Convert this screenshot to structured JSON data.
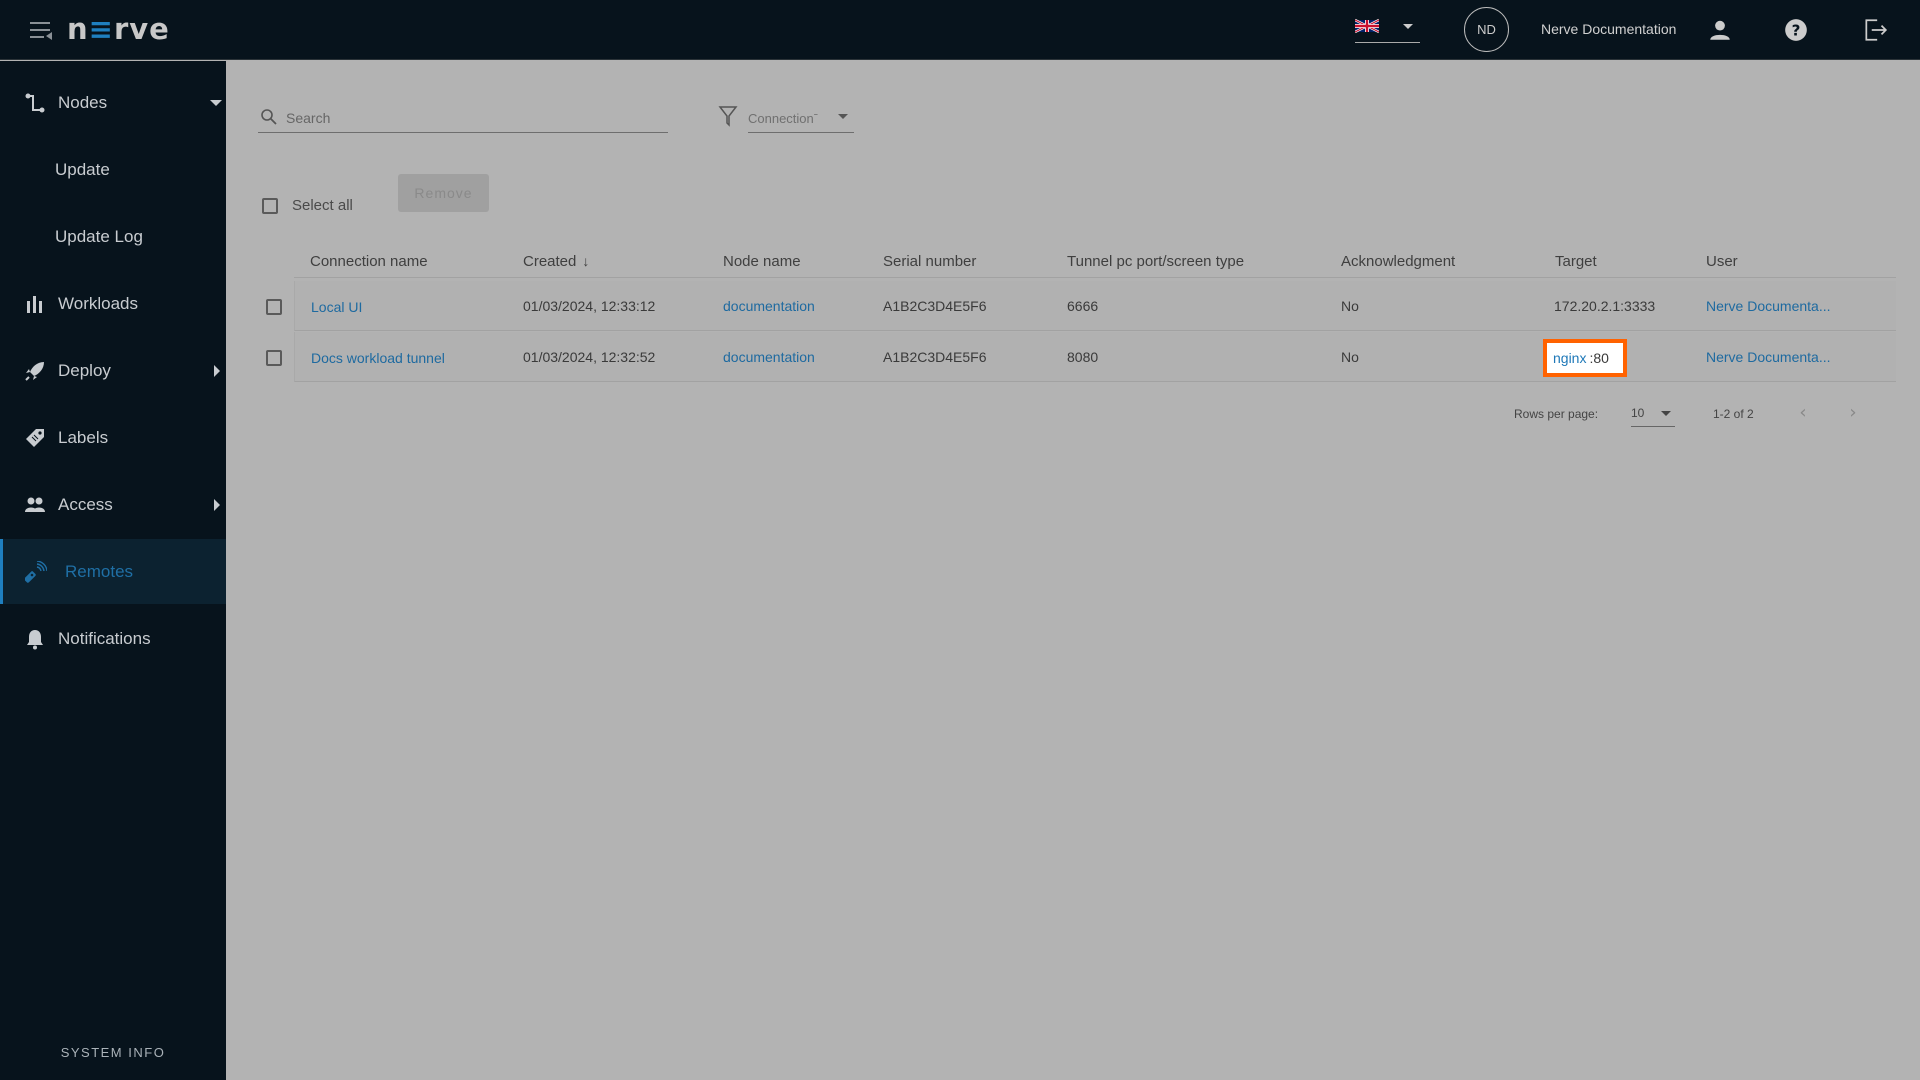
{
  "header": {
    "logo": {
      "pre": "n",
      "mid": "≡",
      "post": "rve"
    },
    "language": "en-GB",
    "avatar_initials": "ND",
    "username": "Nerve Documentation",
    "icons": [
      "menu-icon",
      "uk-flag-icon",
      "user-icon",
      "help-icon",
      "logout-icon"
    ]
  },
  "sidebar": {
    "items": [
      {
        "label": "Nodes",
        "icon": "nodes-icon",
        "expanded": true
      },
      {
        "label": "Update",
        "sub": true
      },
      {
        "label": "Update Log",
        "sub": true
      },
      {
        "label": "Workloads",
        "icon": "workloads-icon"
      },
      {
        "label": "Deploy",
        "icon": "rocket-icon",
        "has_submenu": true
      },
      {
        "label": "Labels",
        "icon": "tag-icon"
      },
      {
        "label": "Access",
        "icon": "users-icon",
        "has_submenu": true
      },
      {
        "label": "Remotes",
        "icon": "remote-icon",
        "active": true
      },
      {
        "label": "Notifications",
        "icon": "bell-icon"
      }
    ],
    "system_info": "SYSTEM INFO"
  },
  "toolbar": {
    "search_placeholder": "Search",
    "filter_value": "Connectionˉ",
    "select_all_label": "Select all",
    "remove_label": "Remove"
  },
  "table": {
    "columns": [
      "Connection name",
      "Created",
      "Node name",
      "Serial number",
      "Tunnel pc port/screen type",
      "Acknowledgment",
      "Target",
      "User"
    ],
    "sort_indicator": "↓",
    "rows": [
      {
        "connection_name": "Local UI",
        "created": "01/03/2024, 12:33:12",
        "node_name": "documentation",
        "serial_number": "A1B2C3D4E5F6",
        "tunnel_port": "6666",
        "acknowledgment": "No",
        "target": "172.20.2.1:3333",
        "user": "Nerve Documenta..."
      },
      {
        "connection_name": "Docs workload tunnel",
        "created": "01/03/2024, 12:32:52",
        "node_name": "documentation",
        "serial_number": "A1B2C3D4E5F6",
        "tunnel_port": "8080",
        "acknowledgment": "No",
        "target_service": "nginx",
        "target_port": ":80",
        "user": "Nerve Documenta..."
      }
    ]
  },
  "pagination": {
    "rows_per_page_label": "Rows per page:",
    "rows_per_page": "10",
    "range": "1-2 of 2",
    "prev": "‹",
    "next": "›"
  },
  "colors": {
    "accent": "#1f7fbf",
    "highlight": "#ff6200",
    "sidebar_bg": "#07131c",
    "overlay": "#b3b3b3"
  }
}
